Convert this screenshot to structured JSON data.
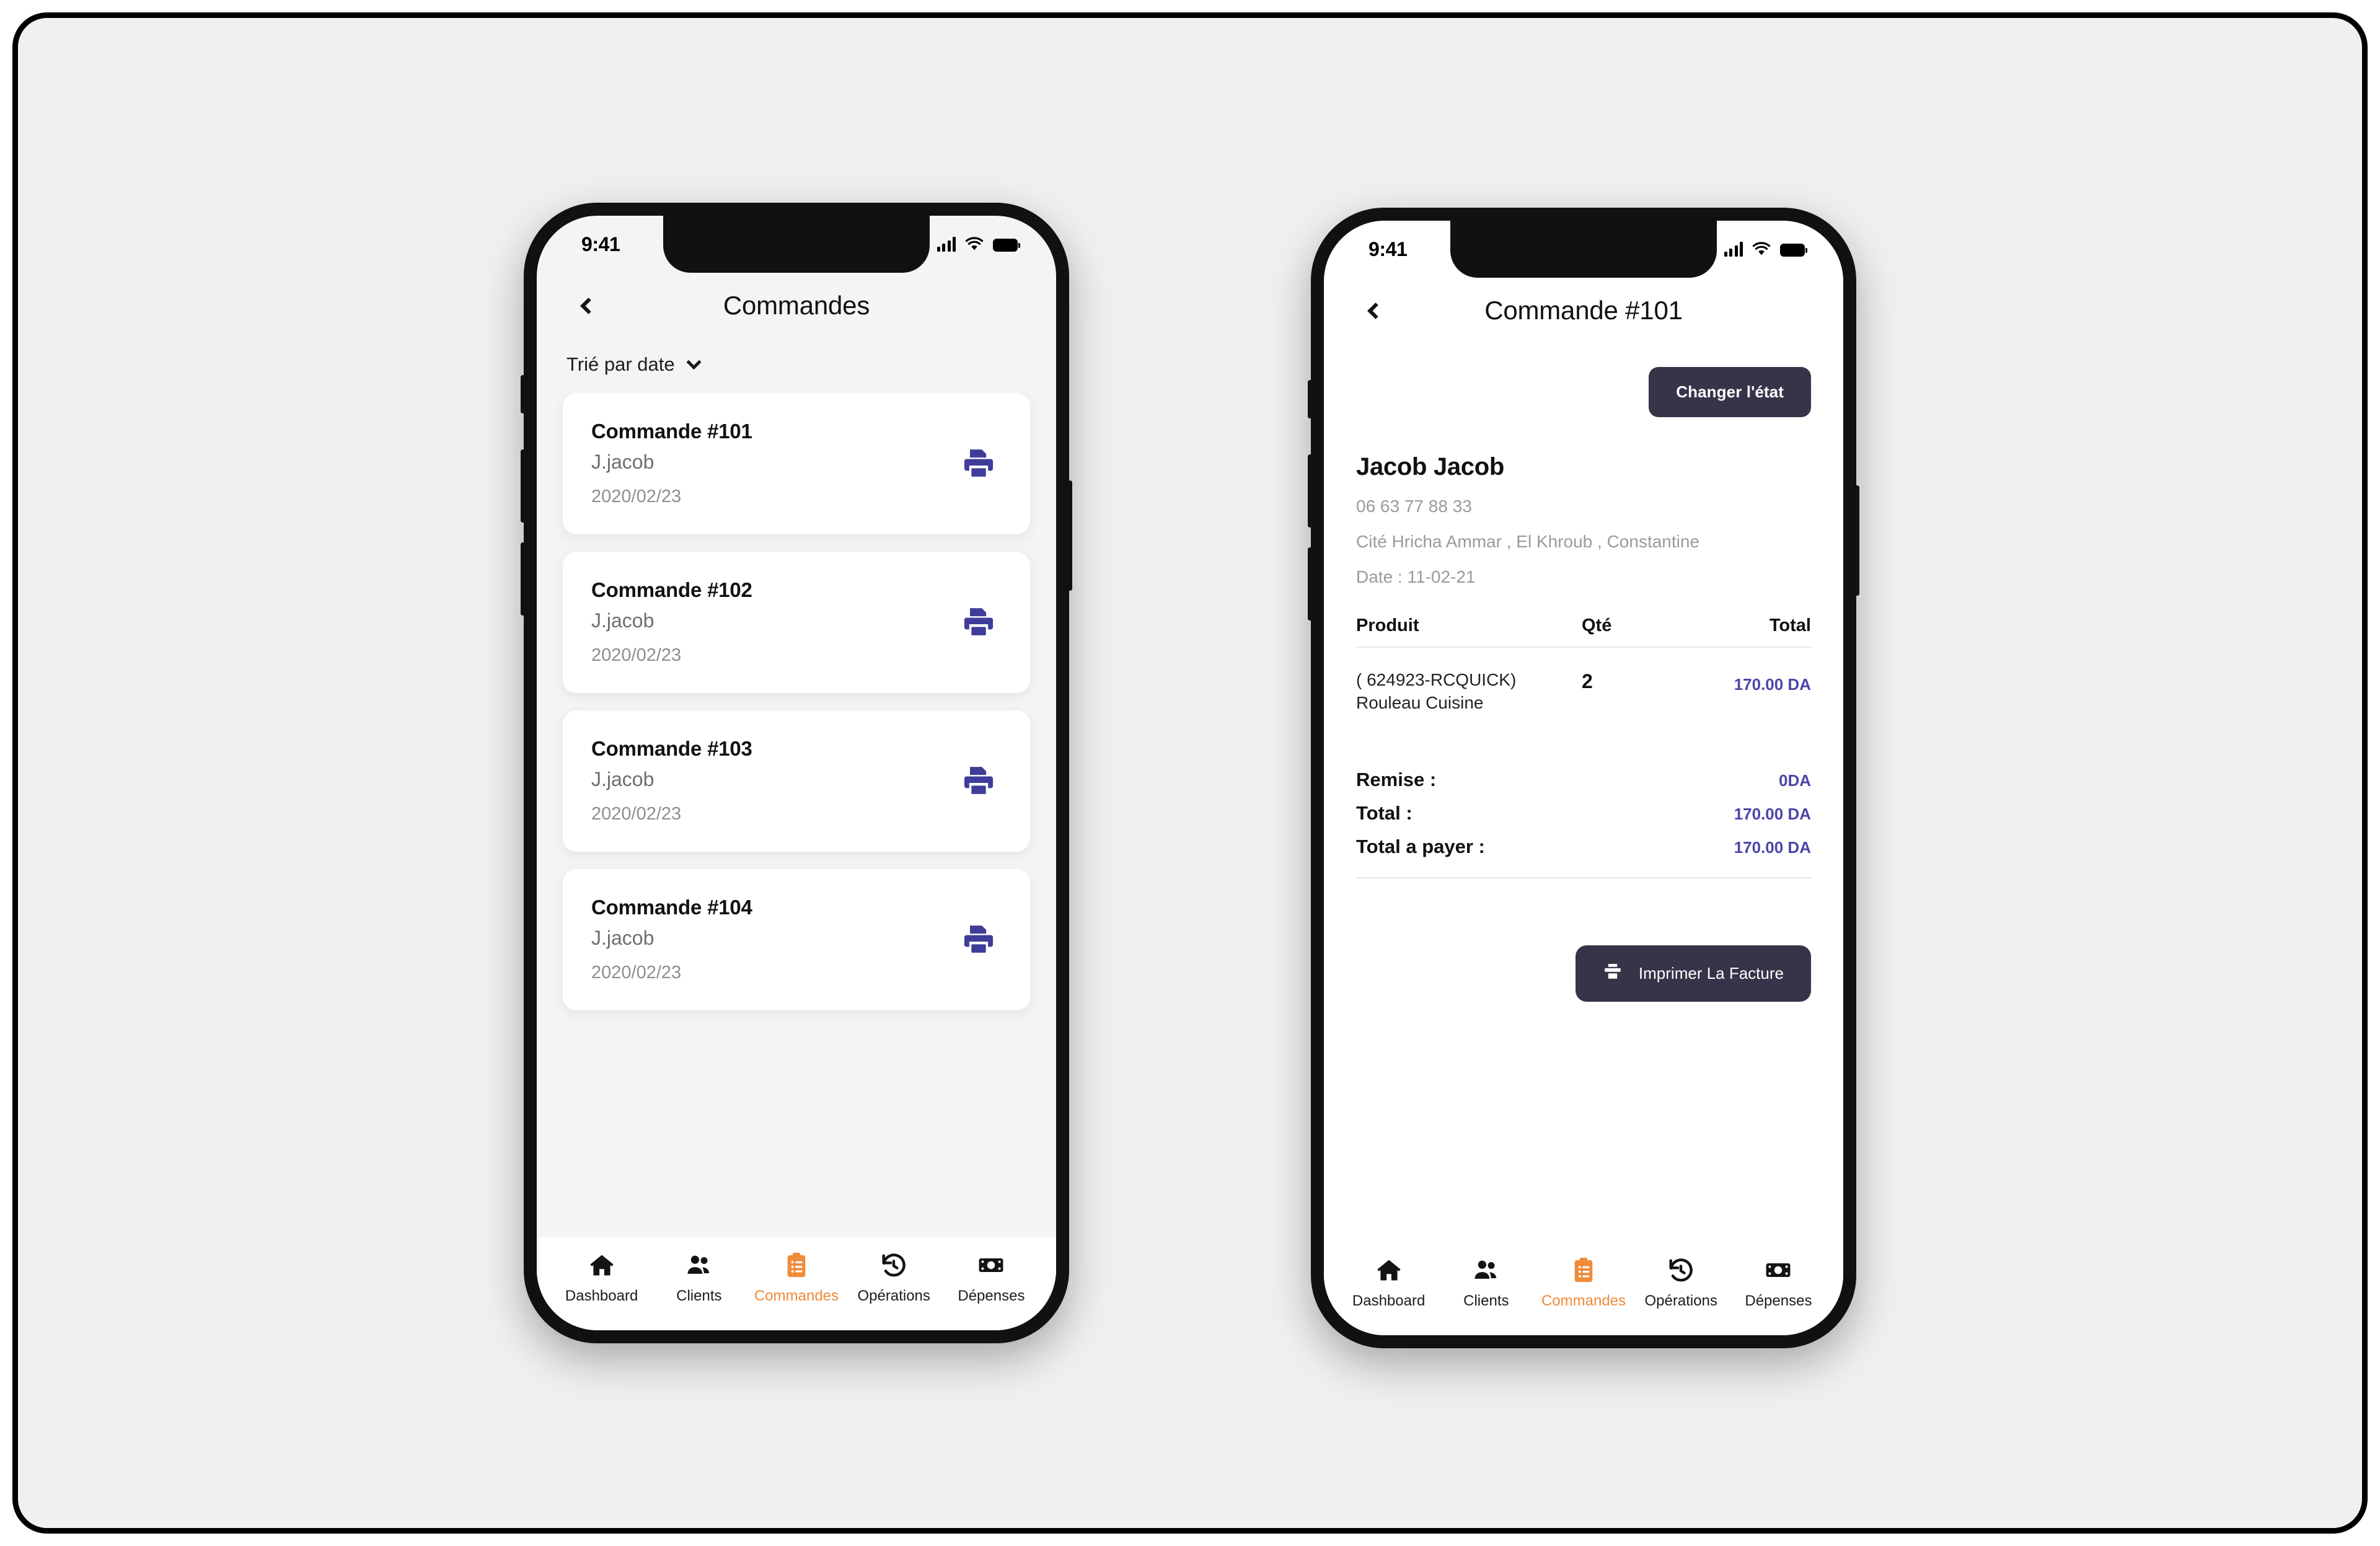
{
  "theme": {
    "canvas_bg": "#f0f0f0",
    "screen_bg_list": "#f4f4f5",
    "screen_bg_detail": "#ffffff",
    "card_bg": "#ffffff",
    "accent_purple": "#3f3d99",
    "price_indigo": "#4a46a8",
    "button_dark": "#373349",
    "tab_active": "#f08b3a",
    "muted_text": "#8e8e93"
  },
  "status_bar": {
    "time": "9:41",
    "signal_icon": "cellular-signal-icon",
    "wifi_icon": "wifi-icon",
    "battery_icon": "battery-full-icon"
  },
  "list_screen": {
    "back_icon": "chevron-left-icon",
    "title": "Commandes",
    "sort": {
      "label": "Trié par date",
      "chevron_icon": "chevron-down-icon"
    },
    "cards": [
      {
        "title": "Commande #101",
        "client": "J.jacob",
        "date": "2020/02/23",
        "print_icon": "printer-icon"
      },
      {
        "title": "Commande #102",
        "client": "J.jacob",
        "date": "2020/02/23",
        "print_icon": "printer-icon"
      },
      {
        "title": "Commande #103",
        "client": "J.jacob",
        "date": "2020/02/23",
        "print_icon": "printer-icon"
      },
      {
        "title": "Commande #104",
        "client": "J.jacob",
        "date": "2020/02/23",
        "print_icon": "printer-icon"
      }
    ]
  },
  "detail_screen": {
    "back_icon": "chevron-left-icon",
    "title": "Commande #101",
    "change_state_button": "Changer l'état",
    "customer": {
      "name": "Jacob Jacob",
      "phone": "06 63 77 88 33",
      "address": "Cité Hricha Ammar  , El Khroub , Constantine",
      "date": "Date : 11-02-21"
    },
    "table": {
      "headers": {
        "product": "Produit",
        "qty": "Qté",
        "total": "Total"
      },
      "rows": [
        {
          "code": "( 624923-RCQUICK)",
          "name": "Rouleau Cuisine",
          "qty": "2",
          "total": "170.00 DA"
        }
      ]
    },
    "totals": [
      {
        "label": "Remise :",
        "value": "0DA"
      },
      {
        "label": "Total :",
        "value": "170.00 DA"
      },
      {
        "label": "Total a payer :",
        "value": "170.00 DA"
      }
    ],
    "print_button": {
      "label": "Imprimer La Facture",
      "icon": "printer-icon"
    }
  },
  "tabbar": {
    "items": [
      {
        "label": "Dashboard",
        "icon": "home-icon",
        "active": false
      },
      {
        "label": "Clients",
        "icon": "people-icon",
        "active": false
      },
      {
        "label": "Commandes",
        "icon": "clipboard-icon",
        "active": true
      },
      {
        "label": "Opérations",
        "icon": "history-icon",
        "active": false
      },
      {
        "label": "Dépenses",
        "icon": "money-icon",
        "active": false
      }
    ]
  }
}
